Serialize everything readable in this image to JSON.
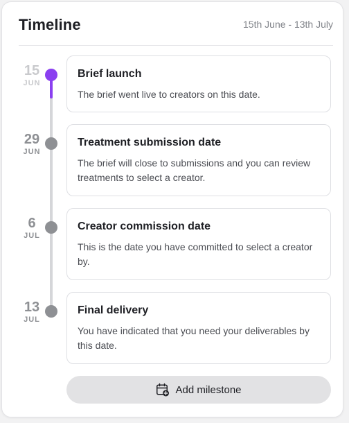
{
  "header": {
    "title": "Timeline",
    "date_range": "15th June - 13th July"
  },
  "colors": {
    "accent": "#8a3ff0",
    "inactive_dot": "#8e9094",
    "track": "#d5d6d9"
  },
  "milestones": [
    {
      "day": "15",
      "month": "JUN",
      "title": "Brief launch",
      "description": "The brief went live to creators on this date.",
      "status": "completed"
    },
    {
      "day": "29",
      "month": "JUN",
      "title": "Treatment submission date",
      "description": "The brief will close to submissions and you can review treatments to select a creator.",
      "status": "upcoming"
    },
    {
      "day": "6",
      "month": "JUL",
      "title": "Creator commission date",
      "description": "This is the date you have committed to select a creator by.",
      "status": "upcoming"
    },
    {
      "day": "13",
      "month": "JUL",
      "title": "Final delivery",
      "description": "You have indicated that you need your deliverables by this date.",
      "status": "upcoming"
    }
  ],
  "add_button": {
    "label": "Add milestone",
    "icon": "calendar-add-icon"
  }
}
